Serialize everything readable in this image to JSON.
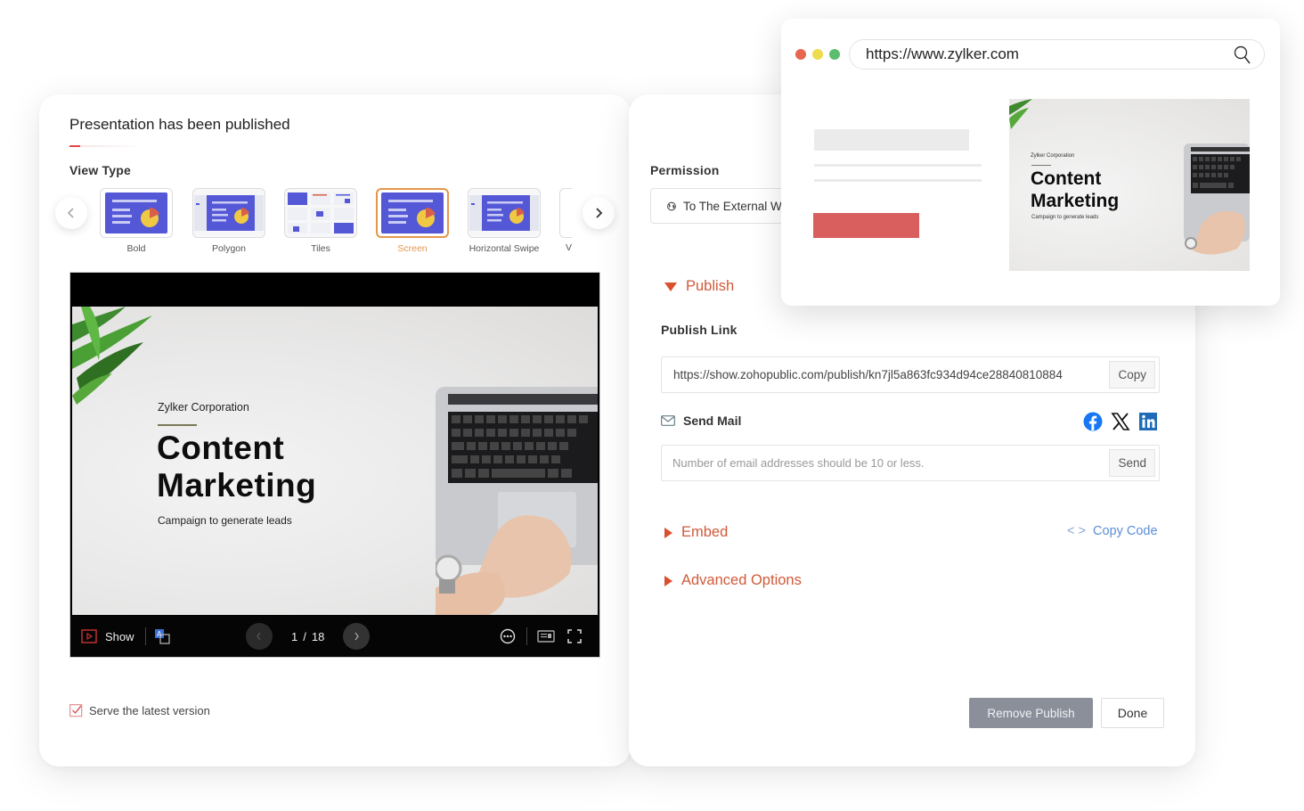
{
  "dialog": {
    "title": "Presentation has been published",
    "view_type_label": "View Type",
    "view_types": [
      {
        "label": "Bold",
        "selected": false
      },
      {
        "label": "Polygon",
        "selected": false
      },
      {
        "label": "Tiles",
        "selected": false
      },
      {
        "label": "Screen",
        "selected": true
      },
      {
        "label": "Horizontal Swipe",
        "selected": false
      },
      {
        "label": "V",
        "selected": false
      }
    ],
    "preview": {
      "slide": {
        "company": "Zylker Corporation",
        "title_line1": "Content",
        "title_line2": "Marketing",
        "subtitle": "Campaign to generate leads"
      },
      "toolbar": {
        "show_label": "Show",
        "current_page": "1",
        "separator": "/",
        "total_pages": "18"
      }
    },
    "serve_latest": {
      "label": "Serve the latest version",
      "checked": true
    },
    "permission": {
      "label": "Permission",
      "value": "To The External World"
    },
    "publish": {
      "section_label": "Publish",
      "expanded": true,
      "link_label": "Publish Link",
      "link_value": "https://show.zohopublic.com/publish/kn7jl5a863fc934d94ce28840810884",
      "copy_label": "Copy",
      "send_mail_label": "Send Mail",
      "email_placeholder": "Number of email addresses should be 10 or less.",
      "send_label": "Send",
      "social": [
        "facebook",
        "x",
        "linkedin"
      ]
    },
    "embed": {
      "label": "Embed",
      "expanded": false,
      "copy_code_prefix": "< >",
      "copy_code_label": "Copy Code"
    },
    "advanced": {
      "label": "Advanced Options",
      "expanded": false
    },
    "buttons": {
      "remove_publish": "Remove Publish",
      "done": "Done"
    }
  },
  "browser_mockup": {
    "url": "https://www.zylker.com",
    "slide": {
      "company": "Zylker Corporation",
      "title_line1": "Content",
      "title_line2": "Marketing",
      "subtitle": "Campaign to generate leads"
    }
  },
  "colors": {
    "accent_orange": "#d9502f",
    "selected_thumb": "#e3974a",
    "link_blue": "#5b8ed6",
    "remove_button": "#8a8f9a",
    "thumb_purple": "#5457d6",
    "cta_red": "#d95f5f"
  }
}
